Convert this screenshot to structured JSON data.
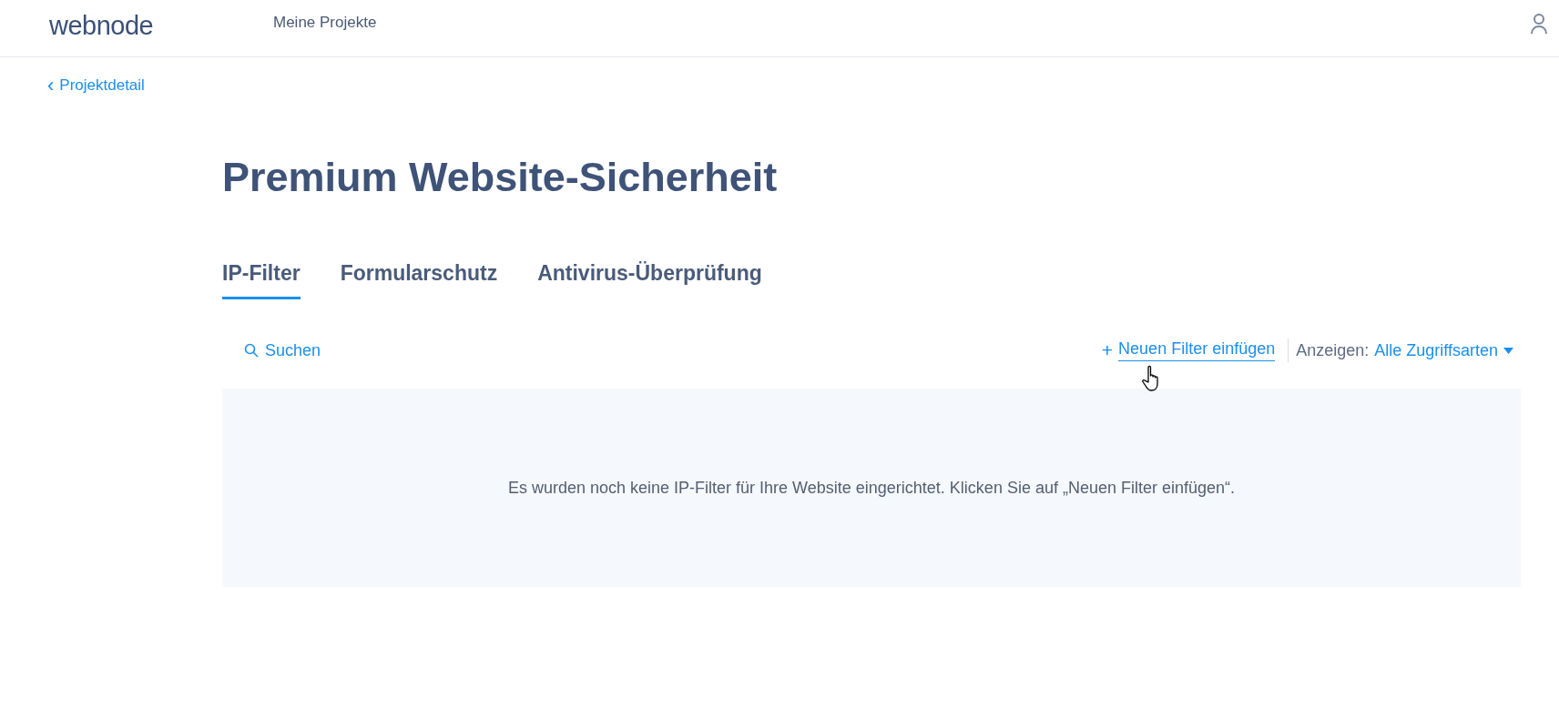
{
  "header": {
    "logo": "webnode",
    "nav_item": "Meine Projekte"
  },
  "back_link": {
    "icon": "‹",
    "label": "Projektdetail"
  },
  "title": "Premium Website-Sicherheit",
  "tabs": [
    {
      "label": "IP-Filter",
      "selected": true
    },
    {
      "label": "Formularschutz",
      "selected": false
    },
    {
      "label": "Antivirus-Überprüfung",
      "selected": false
    }
  ],
  "toolbar": {
    "search": "Suchen",
    "add_icon": "+",
    "add_filter": "Neuen Filter einfügen",
    "show_label": "Anzeigen:",
    "show_value": "Alle Zugriffsarten"
  },
  "empty_message": "Es wurden noch keine IP-Filter für Ihre Website eingerichtet. Klicken Sie auf „Neuen Filter einfügen“."
}
